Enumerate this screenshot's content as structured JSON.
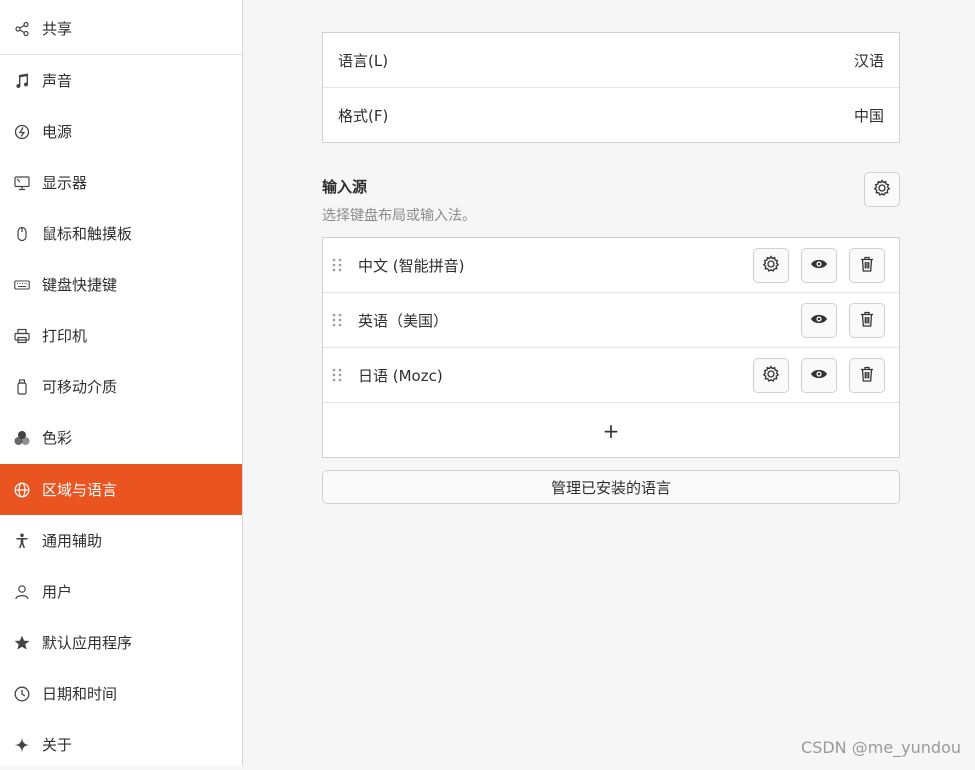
{
  "sidebar": {
    "items": [
      {
        "label": "共享",
        "icon": "share-icon"
      },
      {
        "label": "声音",
        "icon": "music-note-icon"
      },
      {
        "label": "电源",
        "icon": "power-icon"
      },
      {
        "label": "显示器",
        "icon": "display-icon"
      },
      {
        "label": "鼠标和触摸板",
        "icon": "mouse-icon"
      },
      {
        "label": "键盘快捷键",
        "icon": "keyboard-icon"
      },
      {
        "label": "打印机",
        "icon": "printer-icon"
      },
      {
        "label": "可移动介质",
        "icon": "removable-media-icon"
      },
      {
        "label": "色彩",
        "icon": "color-icon"
      },
      {
        "label": "区域与语言",
        "icon": "globe-icon",
        "active": true
      },
      {
        "label": "通用辅助",
        "icon": "accessibility-icon"
      },
      {
        "label": "用户",
        "icon": "users-icon"
      },
      {
        "label": "默认应用程序",
        "icon": "star-icon"
      },
      {
        "label": "日期和时间",
        "icon": "clock-icon"
      },
      {
        "label": "关于",
        "icon": "sparkle-icon"
      }
    ]
  },
  "language_panel": {
    "language": {
      "label": "语言(L)",
      "value": "汉语"
    },
    "format": {
      "label": "格式(F)",
      "value": "中国"
    }
  },
  "input_sources": {
    "title": "输入源",
    "subtitle": "选择键盘布局或输入法。",
    "items": [
      {
        "label": "中文 (智能拼音)",
        "has_settings": true
      },
      {
        "label": "英语（美国）",
        "has_settings": false
      },
      {
        "label": "日语 (Mozc)",
        "has_settings": true
      }
    ],
    "add_label": "+"
  },
  "manage_button_label": "管理已安装的语言",
  "watermark": "CSDN @me_yundou",
  "colors": {
    "accent": "#e95420",
    "background": "#f6f6f6"
  }
}
